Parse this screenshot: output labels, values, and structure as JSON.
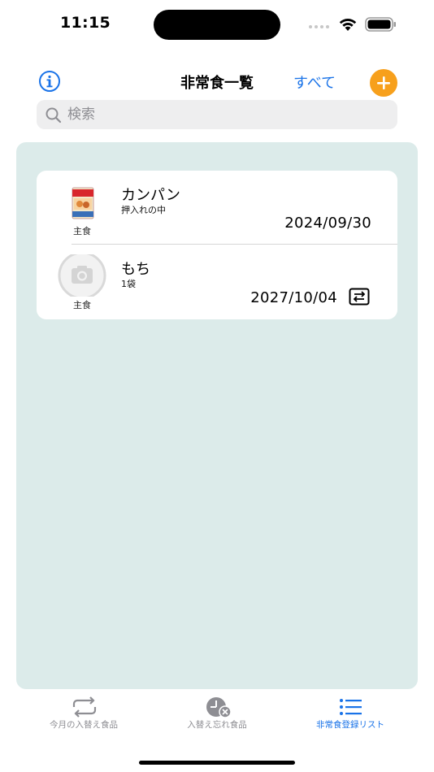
{
  "status_bar": {
    "time": "11:15"
  },
  "nav": {
    "title": "非常食一覧",
    "filter_label": "すべて",
    "info_icon": "info-icon",
    "add_icon": "plus-icon",
    "accent_color": "#1a73e8",
    "add_color": "#f7a01c"
  },
  "search": {
    "placeholder": "検索",
    "value": ""
  },
  "food_list": [
    {
      "name": "カンパン",
      "sub": "押入れの中",
      "category": "主食",
      "date": "2024/09/30",
      "image": "canned-bread-image"
    },
    {
      "name": "もち",
      "sub": "1袋",
      "category": "主食",
      "date": "2027/10/04",
      "image": "camera-placeholder-icon",
      "badge_icon": "swap-icon"
    }
  ],
  "tab_bar": {
    "tabs": [
      {
        "label": "今月の入替え食品",
        "icon": "repeat-icon",
        "selected": false
      },
      {
        "label": "入替え忘れ食品",
        "icon": "clock-cancel-icon",
        "selected": false
      },
      {
        "label": "非常食登録リスト",
        "icon": "list-icon",
        "selected": true
      }
    ]
  },
  "colors": {
    "panel_background": "#dcebea",
    "selected_tab": "#1a73e8",
    "unselected_tab": "#8e8e93"
  }
}
